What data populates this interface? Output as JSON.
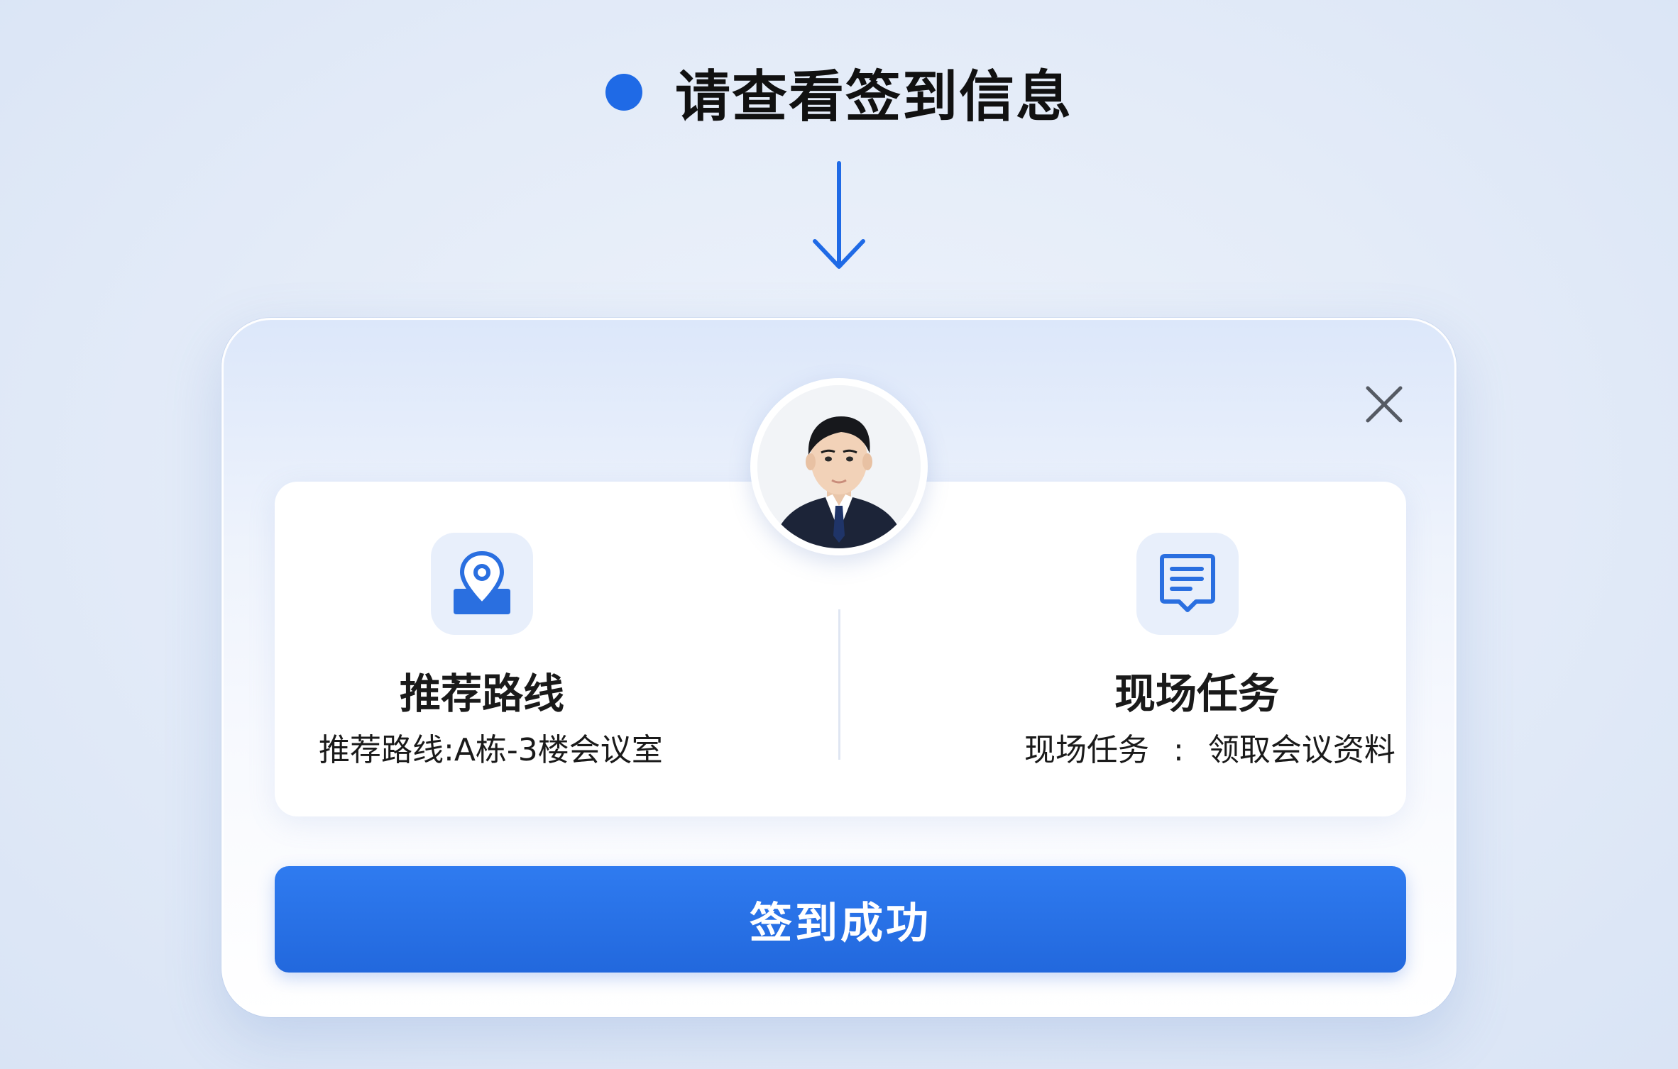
{
  "header": {
    "title": "请查看签到信息",
    "dot_color": "#1f6ae6",
    "arrow_icon": "arrow-down-icon"
  },
  "modal": {
    "close_icon": "close-icon",
    "avatar_icon": "user-avatar",
    "route": {
      "icon": "map-pin-icon",
      "title": "推荐路线",
      "detail": "推荐路线:A栋-3楼会议室"
    },
    "task": {
      "icon": "document-icon",
      "title": "现场任务",
      "label": "现场任务",
      "separator": ":",
      "value": "领取会议资料"
    },
    "confirm_label": "签到成功",
    "accent_color": "#2a73ea"
  }
}
